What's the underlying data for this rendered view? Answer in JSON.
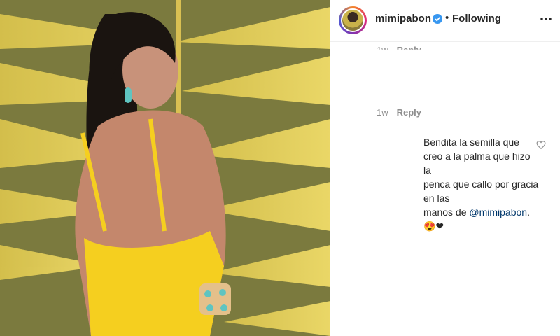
{
  "post": {
    "username": "mimipabon",
    "separator": "•",
    "follow_status": "Following",
    "icons": {
      "verified": "verified-badge-icon",
      "more": "more-options-icon",
      "heart": "heart-icon"
    },
    "colors": {
      "verified": "#3897f0",
      "mention": "#00376b",
      "meta": "#8e8e8e"
    }
  },
  "comments": [
    {
      "time": "1w",
      "reply_label": "Reply"
    },
    {
      "time": "1w",
      "reply_label": "Reply"
    },
    {
      "text_lines": [
        "Bendita la semilla que",
        "creo a la palma que hizo la",
        "penca que callo por gracia en las",
        "manos de "
      ],
      "mention": "@mimipabon",
      "after_mention": ". 😍❤"
    }
  ]
}
